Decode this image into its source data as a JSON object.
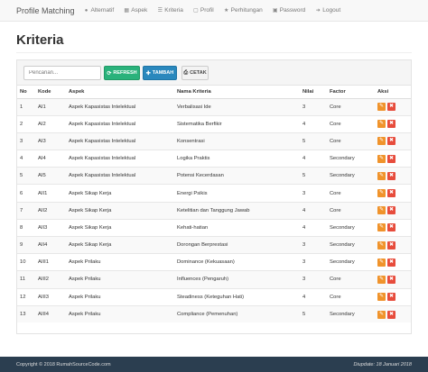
{
  "navbar": {
    "brand": "Profile Matching",
    "items": [
      {
        "label": "Alternatif",
        "icon": "user-icon"
      },
      {
        "label": "Aspek",
        "icon": "grid-icon"
      },
      {
        "label": "Kriteria",
        "icon": "list-icon"
      },
      {
        "label": "Profil",
        "icon": "file-icon"
      },
      {
        "label": "Perhitungan",
        "icon": "star-icon"
      },
      {
        "label": "Password",
        "icon": "lock-icon"
      },
      {
        "label": "Logout",
        "icon": "logout-icon"
      }
    ]
  },
  "page": {
    "title": "Kriteria"
  },
  "toolbar": {
    "search_placeholder": "Pencarian...",
    "refresh_label": "REFRESH",
    "tambah_label": "TAMBAH",
    "cetak_label": "CETAK"
  },
  "table": {
    "headers": [
      "No",
      "Kode",
      "Aspek",
      "Nama Kriteria",
      "Nilai",
      "Factor",
      "Aksi"
    ],
    "rows": [
      [
        "1",
        "AI1",
        "Aspek Kapasistas Intelektual",
        "Verbalisasi Ide",
        "3",
        "Core"
      ],
      [
        "2",
        "AI2",
        "Aspek Kapasistas Intelektual",
        "Sistematika Berfikir",
        "4",
        "Core"
      ],
      [
        "3",
        "AI3",
        "Aspek Kapasistas Intelektual",
        "Konsentrasi",
        "5",
        "Core"
      ],
      [
        "4",
        "AI4",
        "Aspek Kapasistas Intelektual",
        "Logika Praktis",
        "4",
        "Secondary"
      ],
      [
        "5",
        "AI5",
        "Aspek Kapasistas Intelektual",
        "Potensi Kecerdasan",
        "5",
        "Secondary"
      ],
      [
        "6",
        "AII1",
        "Aspek Sikap Kerja",
        "Energi Psikis",
        "3",
        "Core"
      ],
      [
        "7",
        "AII2",
        "Aspek Sikap Kerja",
        "Ketelitian dan Tanggung Jawab",
        "4",
        "Core"
      ],
      [
        "8",
        "AII3",
        "Aspek Sikap Kerja",
        "Kehati-hatian",
        "4",
        "Secondary"
      ],
      [
        "9",
        "AII4",
        "Aspek Sikap Kerja",
        "Dorongan Berprestasi",
        "3",
        "Secondary"
      ],
      [
        "10",
        "AIII1",
        "Aspek Prilaku",
        "Dominance (Kekuasaan)",
        "3",
        "Secondary"
      ],
      [
        "11",
        "AIII2",
        "Aspek Prilaku",
        "Influences (Pengaruh)",
        "3",
        "Core"
      ],
      [
        "12",
        "AIII3",
        "Aspek Prilaku",
        "Steadiness (Keteguhan Hati)",
        "4",
        "Core"
      ],
      [
        "13",
        "AIII4",
        "Aspek Prilaku",
        "Compliance (Pemenuhan)",
        "5",
        "Secondary"
      ]
    ]
  },
  "footer": {
    "copyright": "Copyright © 2018 RumahSourceCode.com",
    "updated": "Diupdate: 18 Januari 2018"
  },
  "colors": {
    "refresh": "#2ab27b",
    "tambah": "#2a88bd",
    "edit": "#f0932b",
    "delete": "#e74c3c",
    "footer": "#2b3e50"
  }
}
